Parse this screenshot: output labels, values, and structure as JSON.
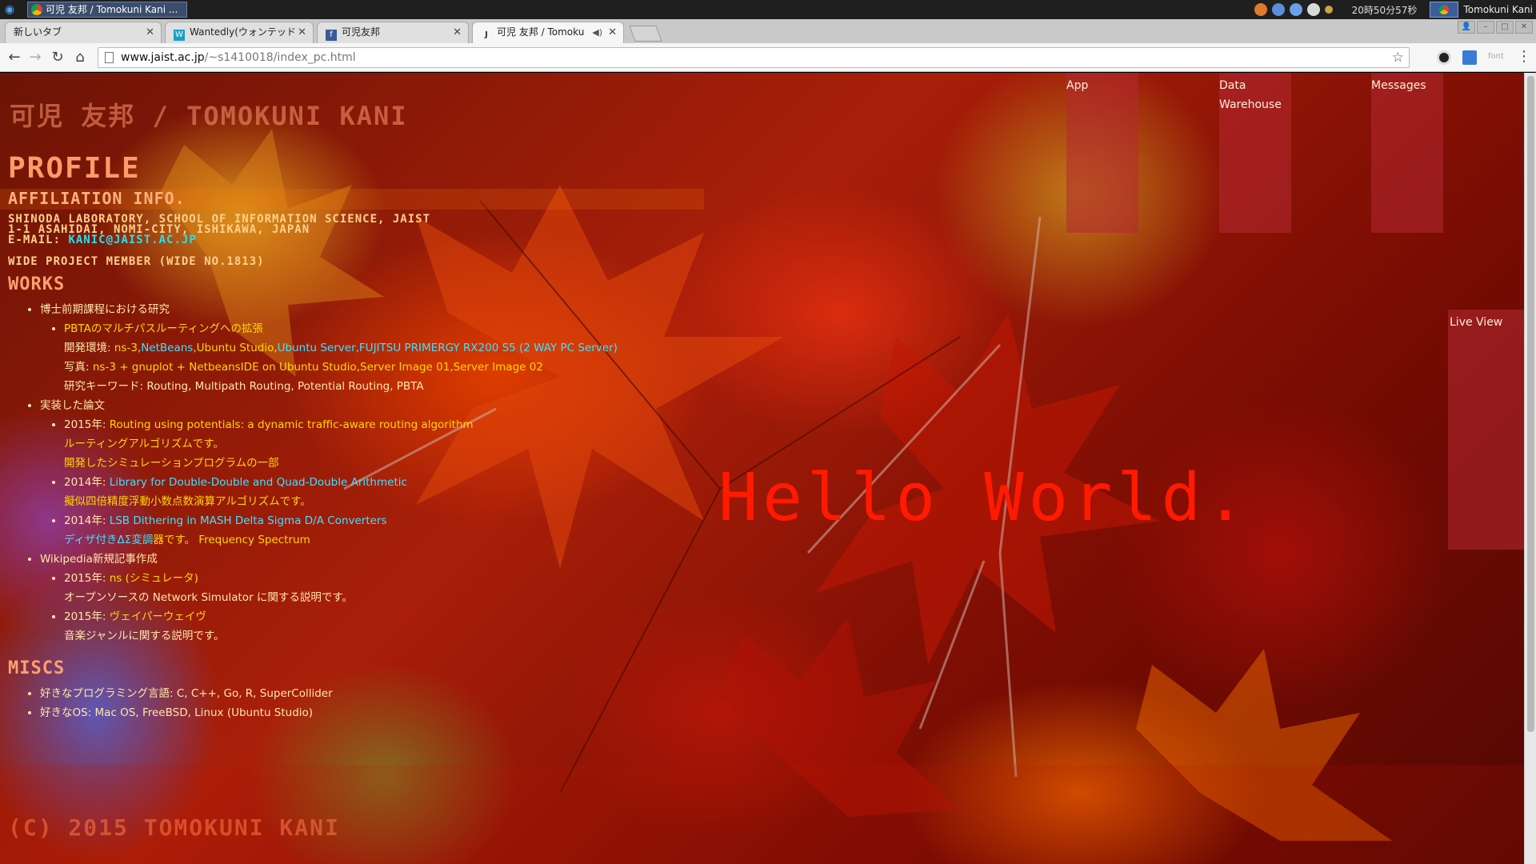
{
  "os": {
    "task_title": "可児 友邦 / Tomokuni Kani ...",
    "clock": "20時50分57秒",
    "user": "Tomokuni Kani"
  },
  "tabs": [
    {
      "label": "新しいタブ"
    },
    {
      "label": "Wantedly(ウォンテッド"
    },
    {
      "label": "可児友邦"
    },
    {
      "label": "可児 友邦 / Tomoku"
    }
  ],
  "toolbar": {
    "url_host": "www.jaist.ac.jp",
    "url_path": "/~s1410018/index_pc.html",
    "ext_label": "font"
  },
  "page": {
    "site_title": "可児 友邦 / TOMOKUNI KANI",
    "profile_heading": "PROFILE",
    "affiliation_heading": "AFFILIATION INFO.",
    "affiliation_lab": "SHINODA LABORATORY, SCHOOL OF INFORMATION SCIENCE, JAIST",
    "affiliation_address": "1-1 ASAHIDAI, NOMI-CITY, ISHIKAWA, JAPAN",
    "email_label": "E-MAIL:",
    "email": "KANIC@JAIST.AC.JP",
    "wide_member": "WIDE PROJECT MEMBER (WIDE NO.1813)",
    "works_heading": "WORKS",
    "works": {
      "research_title": "博士前期課程における研究",
      "pbta_title": "PBTAのマルチパスルーティングへの拡張",
      "env_label": "開発環境:",
      "env_ns3": "ns-3,",
      "env_netbeans": "NetBeans",
      "env_ubuntu_studio": ",Ubuntu Studio,",
      "env_ubuntu_server": "Ubuntu Server",
      "env_fujitsu": ",FUJITSU PRIMERGY RX200 S5 (2 WAY PC Server)",
      "photo_label": "写真:",
      "photo_ns3": "ns-3 + gnuplot + NetbeansIDE on Ubuntu Studio",
      "photo_server1": ",Server Image 01",
      "photo_server2": ",Server Image 02",
      "keywords": "研究キーワード: Routing, Multipath Routing, Potential Routing, PBTA",
      "papers_title": "実装した論文",
      "p1_year": "2015年:",
      "p1_link": "Routing using potentials: a dynamic traffic-aware routing algorithm",
      "p1_desc1": "ルーティングアルゴリズムです。",
      "p1_desc2": "開発したシミュレーションプログラムの一部",
      "p2_year": "2014年:",
      "p2_link": "Library for Double-Double and Quad-Double Arithmetic",
      "p2_desc": "擬似四倍精度浮動小数点数演算アルゴリズムです。",
      "p3_year": "2014年:",
      "p3_link": "LSB Dithering in MASH Delta Sigma D/A Converters",
      "p3_desc_link": "ディザ付きΔΣ変調",
      "p3_desc_mid": "器です。",
      "p3_desc_link2": "Frequency Spectrum",
      "wiki_title": "Wikipedia新規記事作成",
      "w1_year": "2015年:",
      "w1_link": "ns (シミュレータ)",
      "w1_desc": "オープンソースの Network Simulator に関する説明です。",
      "w2_year": "2015年:",
      "w2_link": "ヴェイパーウェイヴ",
      "w2_desc": "音楽ジャンルに関する説明です。"
    },
    "miscs_heading": "MISCS",
    "miscs": [
      "好きなプログラミング言語: C, C++, Go, R, SuperCollider",
      "好きなOS: Mac OS, FreeBSD, Linux (Ubuntu Studio)"
    ],
    "hello": "Hello World.",
    "footer": "(C) 2015 TOMOKUNI KANI",
    "side_tiles": {
      "app": "App",
      "data_warehouse_1": "Data",
      "data_warehouse_2": "Warehouse",
      "messages": "Messages",
      "live_view": "Live View"
    }
  },
  "colors": {
    "hello": "#ff1a00",
    "link_yellow": "#ffd600",
    "link_cyan": "#3fe0ff",
    "tile": "#b42832"
  }
}
